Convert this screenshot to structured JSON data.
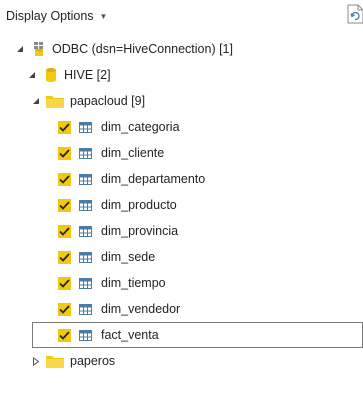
{
  "header": {
    "title": "Display Options",
    "caret_icon": "caret-down-icon"
  },
  "toolbar": {
    "refresh_icon": "refresh-icon"
  },
  "tree": {
    "source": {
      "label": "ODBC (dsn=HiveConnection) [1]",
      "icon": "odbc-datasource-icon",
      "expanded": true
    },
    "database": {
      "label": "HIVE [2]",
      "icon": "database-icon",
      "expanded": true
    },
    "schemas": [
      {
        "label": "papacloud [9]",
        "icon": "folder-icon",
        "expanded": true
      },
      {
        "label": "paperos",
        "icon": "folder-icon",
        "expanded": false
      }
    ],
    "tables": [
      {
        "label": "dim_categoria",
        "checked": true,
        "selected": false
      },
      {
        "label": "dim_cliente",
        "checked": true,
        "selected": false
      },
      {
        "label": "dim_departamento",
        "checked": true,
        "selected": false
      },
      {
        "label": "dim_producto",
        "checked": true,
        "selected": false
      },
      {
        "label": "dim_provincia",
        "checked": true,
        "selected": false
      },
      {
        "label": "dim_sede",
        "checked": true,
        "selected": false
      },
      {
        "label": "dim_tiempo",
        "checked": true,
        "selected": false
      },
      {
        "label": "dim_vendedor",
        "checked": true,
        "selected": false
      },
      {
        "label": "fact_venta",
        "checked": true,
        "selected": true
      }
    ]
  },
  "colors": {
    "checkbox": "#f2c811",
    "folder": "#f2c811",
    "table_icon": "#4a7ca6",
    "selection_border": "#7a7a7a",
    "text": "#252423"
  }
}
